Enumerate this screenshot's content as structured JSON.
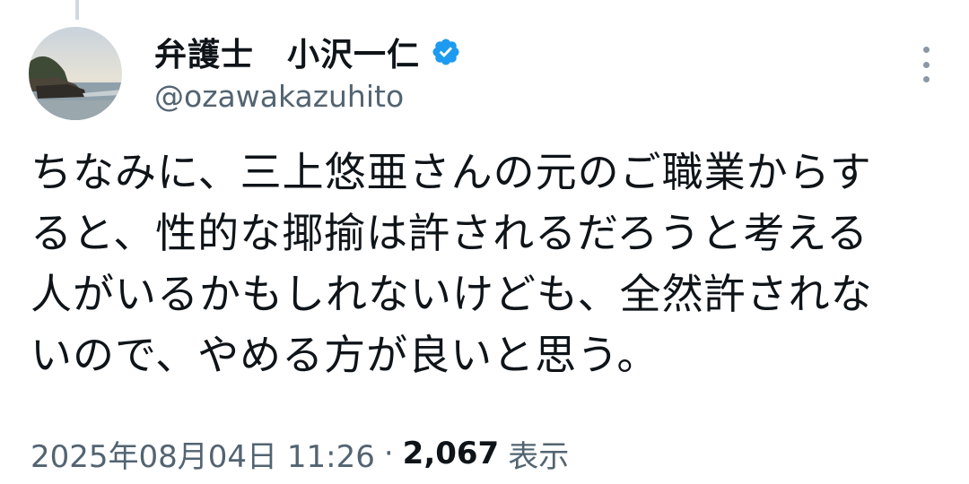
{
  "tweet": {
    "author": {
      "display_name": "弁護士　小沢一仁",
      "handle": "@ozawakazuhito",
      "verified": true,
      "avatar_icon": "avatar-coastal-photo"
    },
    "text": "ちなみに、三上悠亜さんの元のご職業からす\nると、性的な揶揄は許されるだろうと考える\n人がいるかもしれないけども、全然許されな\nいので、やめる方が良いと思う。",
    "timestamp": "2025年08月04日 11:26",
    "separator": "·",
    "views_count": "2,067",
    "views_label": "表示",
    "menu_icon": "more-vertical-icon"
  },
  "colors": {
    "text_primary": "#0f1419",
    "text_secondary": "#536471",
    "verified_blue": "#1d9bf0",
    "thread_line": "#cfd9de"
  }
}
